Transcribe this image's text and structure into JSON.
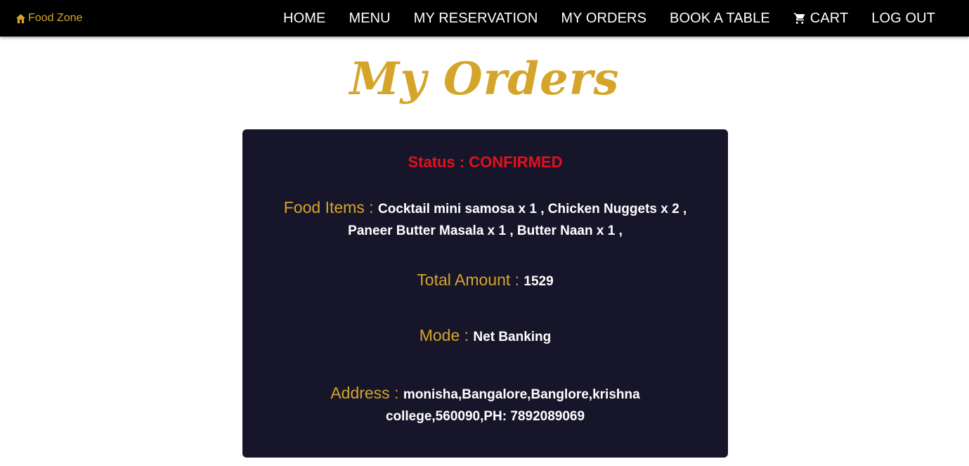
{
  "nav": {
    "brand": "Food Zone",
    "links": [
      {
        "label": "HOME"
      },
      {
        "label": "MENU"
      },
      {
        "label": "MY RESERVATION"
      },
      {
        "label": "MY ORDERS"
      },
      {
        "label": "BOOK A TABLE"
      },
      {
        "label": "CART"
      },
      {
        "label": "LOG OUT"
      }
    ]
  },
  "page": {
    "title": "My Orders"
  },
  "order": {
    "status_label": "Status : ",
    "status_value": "CONFIRMED",
    "items_label": "Food Items : ",
    "items_value": "Cocktail mini samosa x 1 , Chicken Nuggets x 2 , Paneer Butter Masala x 1 , Butter Naan x 1 ,",
    "total_label": "Total Amount : ",
    "total_value": "1529",
    "mode_label": "Mode : ",
    "mode_value": "Net Banking",
    "address_label": "Address : ",
    "address_value": "monisha,Bangalore,Banglore,krishna college,560090,PH: 7892089069"
  },
  "colors": {
    "navbar_bg": "#000000",
    "accent_gold": "#d4a52a",
    "card_bg": "#17152a",
    "status_red": "#e4101c",
    "text_white": "#ffffff"
  },
  "icons": {
    "brand": "home-icon",
    "cart": "cart-icon"
  }
}
